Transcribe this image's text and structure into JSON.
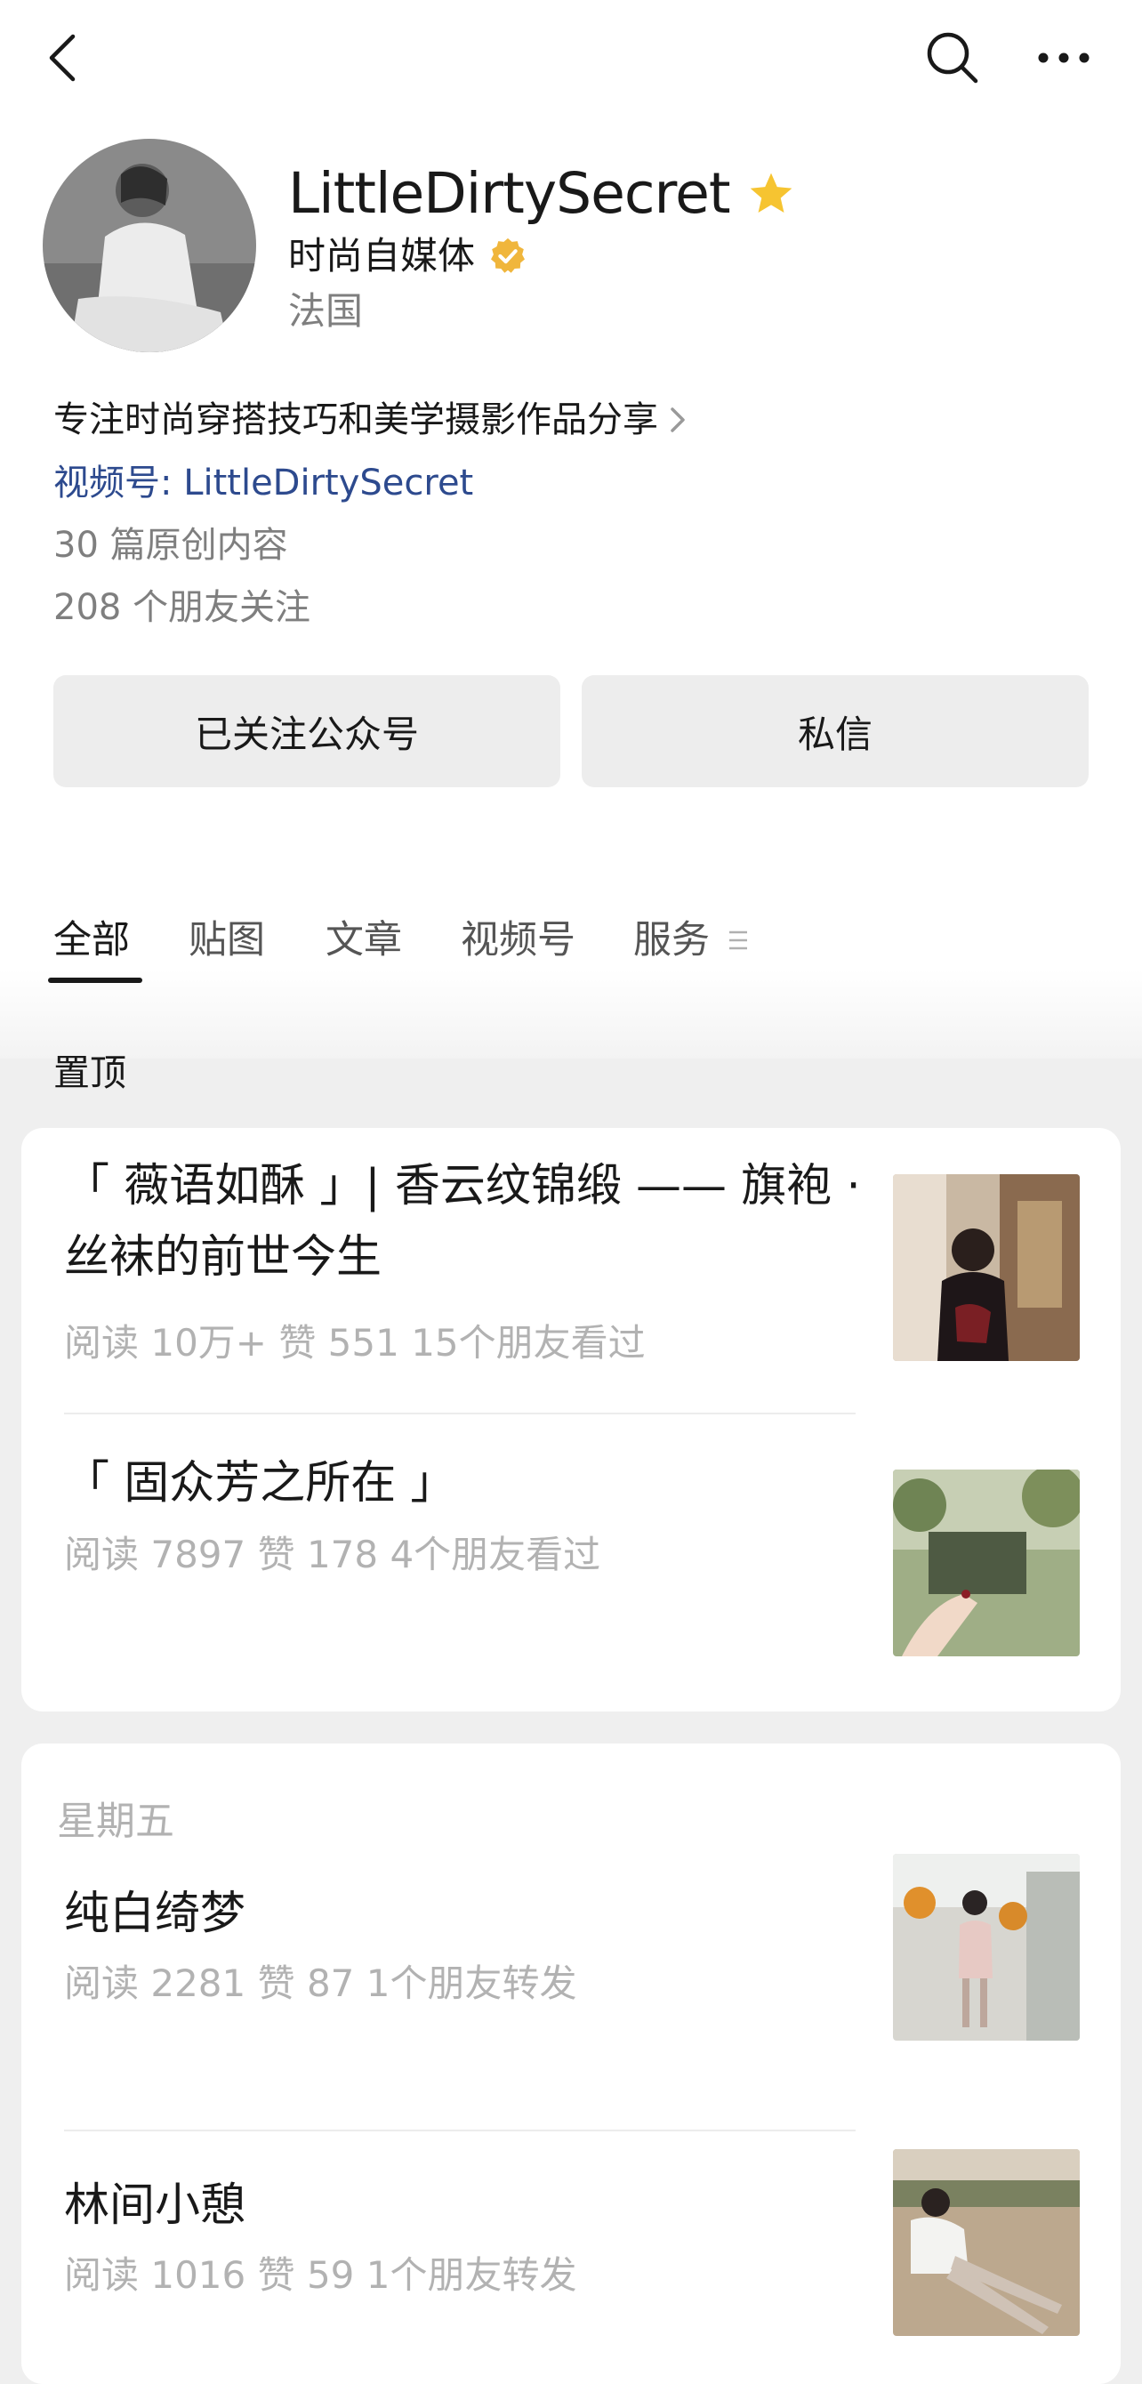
{
  "profile": {
    "name": "LittleDirtySecret",
    "category": "时尚自媒体",
    "region": "法国",
    "bio": "专注时尚穿搭技巧和美学摄影作品分享",
    "channel": "视频号: LittleDirtySecret",
    "original_count": "30 篇原创内容",
    "friends_follow": "208 个朋友关注"
  },
  "actions": {
    "follow_label": "已关注公众号",
    "message_label": "私信"
  },
  "tabs": [
    "全部",
    "贴图",
    "文章",
    "视频号",
    "服务"
  ],
  "pinned": {
    "title": "置顶",
    "articles": [
      {
        "title": "「 薇语如酥 」|  香云纹锦缎 —— 旗袍 · 丝袜的前世今生",
        "meta": "阅读 10万+   赞 551   15个朋友看过"
      },
      {
        "title": "「  固众芳之所在  」",
        "meta": "阅读 7897   赞 178   4个朋友看过"
      }
    ]
  },
  "feed": {
    "day": "星期五",
    "articles": [
      {
        "title": "纯白绮梦",
        "meta": "阅读 2281   赞 87   1个朋友转发"
      },
      {
        "title": "林间小憩",
        "meta": "阅读 1016   赞 59   1个朋友转发"
      }
    ]
  },
  "icons": {
    "back": "back-arrow-icon",
    "search": "search-icon",
    "more": "more-icon",
    "star": "star-icon",
    "verified": "verified-badge-icon",
    "chevron": "chevron-right-icon",
    "menu": "menu-icon"
  },
  "colors": {
    "star": "#f6c431",
    "verified": "#f0b63c",
    "link": "#576b95",
    "meta": "#b2b2b2"
  }
}
